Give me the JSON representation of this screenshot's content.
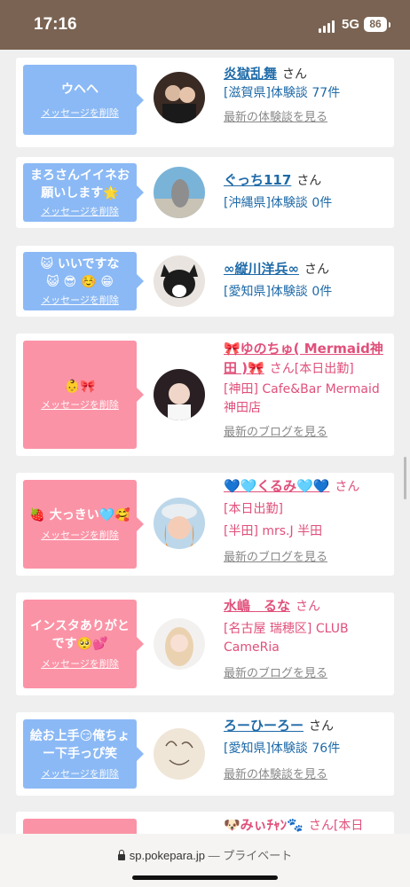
{
  "status": {
    "time": "17:16",
    "network": "5G",
    "battery": "86"
  },
  "browser": {
    "domain": "sp.pokepara.jp",
    "mode": "— プライベート"
  },
  "cards": [
    {
      "bubble_text": "ウヘヘ",
      "delete_label": "メッセージを削除",
      "name": "炎獄乱舞",
      "honorific": "さん",
      "meta1": "[滋賀県]体験談 77件",
      "meta2": "",
      "more_label": "最新の体験談を見る"
    },
    {
      "bubble_text": "まろさんイイネお願いします🌟",
      "delete_label": "メッセージを削除",
      "name": "ぐっち117",
      "honorific": "さん",
      "meta1": "[沖縄県]体験談 0件",
      "meta2": "",
      "more_label": ""
    },
    {
      "bubble_text": "😺 いいですな 😺 😎 ☺️ 😁",
      "delete_label": "メッセージを削除",
      "name": "∞縦川洋兵∞",
      "honorific": "さん",
      "meta1": "[愛知県]体験談 0件",
      "meta2": "",
      "more_label": ""
    },
    {
      "bubble_text": "👶🎀",
      "delete_label": "メッセージを削除",
      "name": "🎀ゆのちゅ( Mermaid神田 )🎀",
      "honorific": "さん[本日出勤]",
      "meta1": "[神田] Cafe&Bar Mermaid 神田店",
      "meta2": "",
      "more_label": "最新のブログを見る"
    },
    {
      "bubble_text": "🍓 大っきい🩵🥰",
      "delete_label": "メッセージを削除",
      "name": "💙🩵くるみ🩵💙",
      "honorific": "さん",
      "meta1": "[本日出勤]",
      "meta2": "[半田] mrs.J 半田",
      "more_label": "最新のブログを見る"
    },
    {
      "bubble_text": "インスタありがとです🥺💕",
      "delete_label": "メッセージを削除",
      "name": "水嶋　るな",
      "honorific": "さん",
      "meta1": "[名古屋 瑞穂区] CLUB CameRia",
      "meta2": "",
      "more_label": "最新のブログを見る"
    },
    {
      "bubble_text": "絵お上手😏俺ちょー下手っぴ笑",
      "delete_label": "メッセージを削除",
      "name": "ろーひーろー",
      "honorific": "さん",
      "meta1": "[愛知県]体験談 76件",
      "meta2": "",
      "more_label": "最新の体験談を見る"
    },
    {
      "bubble_text": "",
      "delete_label": "",
      "name": "🐶みぃﾁｬﾝ🐾",
      "honorific": "さん[本日",
      "meta1": "",
      "meta2": "",
      "more_label": ""
    }
  ]
}
